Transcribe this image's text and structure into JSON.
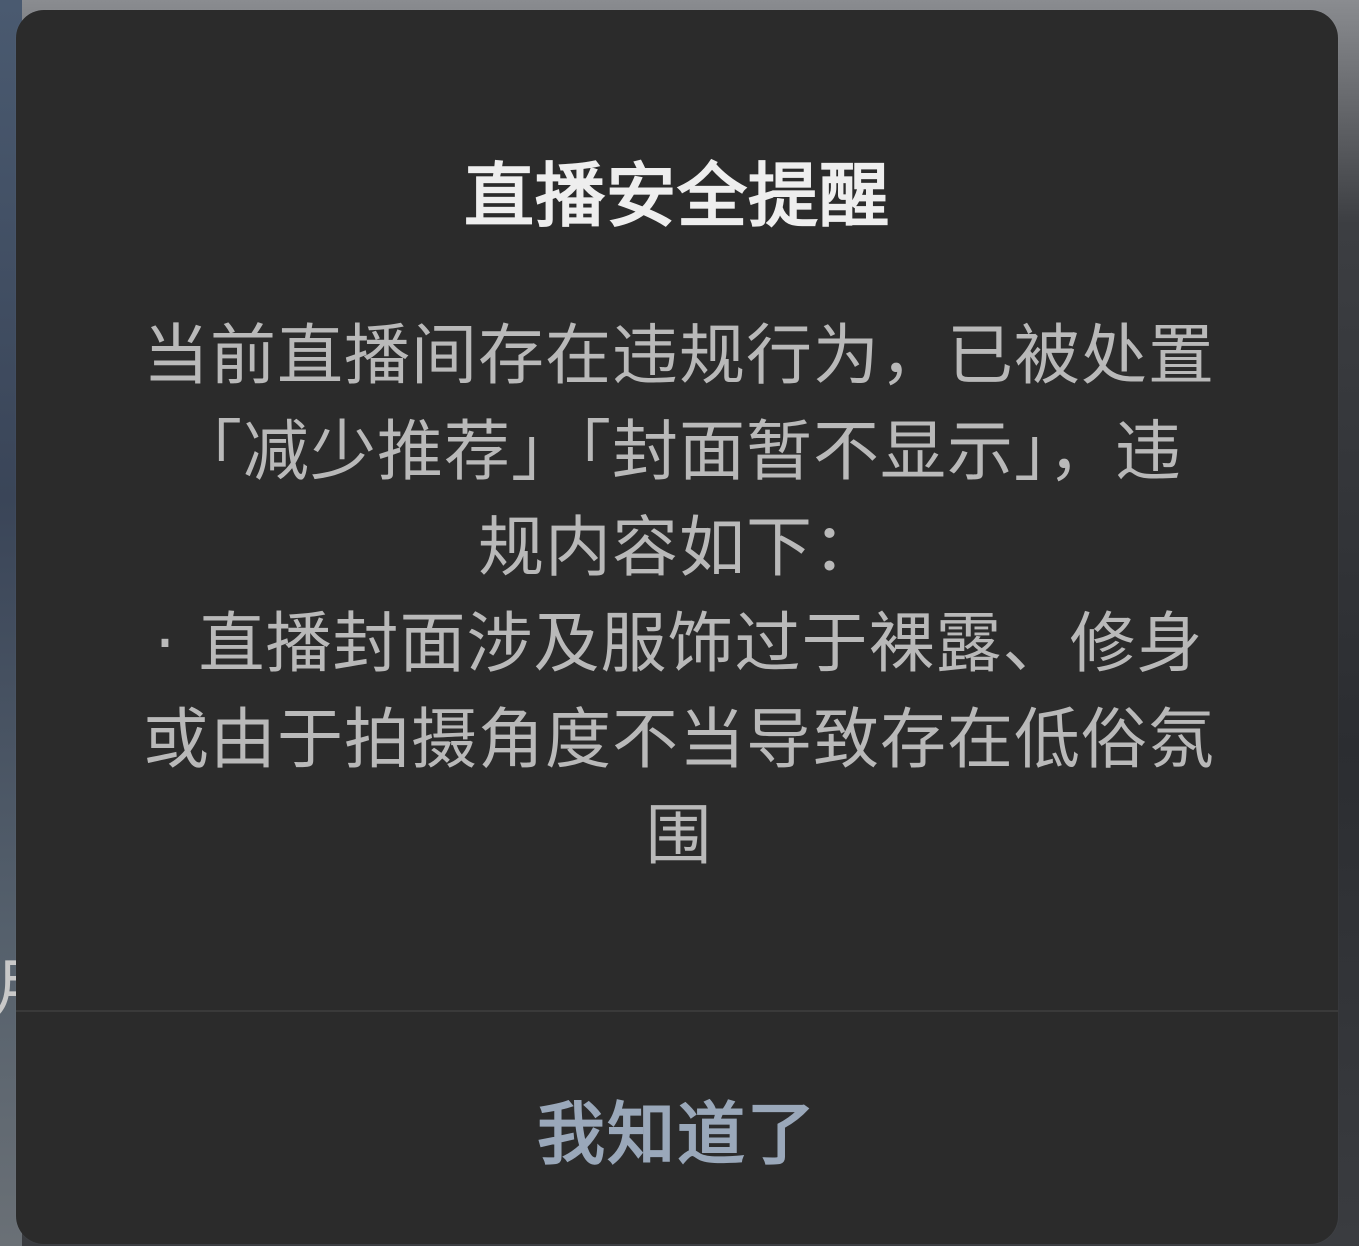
{
  "dialog": {
    "title": "直播安全提醒",
    "message_lines": [
      "当前直播间存在违规行为，已被处置",
      "「减少推荐」「封面暂不显示」，违",
      "规内容如下：",
      "· 直播封面涉及服饰过于裸露、修身",
      "或由于拍摄角度不当导致存在低俗氛",
      "围"
    ],
    "confirm_label": "我知道了"
  },
  "colors": {
    "dialog_background": "#2b2b2b",
    "title_text": "#eeeeee",
    "body_text": "#b9b9b9",
    "button_text": "#9aa8ba"
  }
}
